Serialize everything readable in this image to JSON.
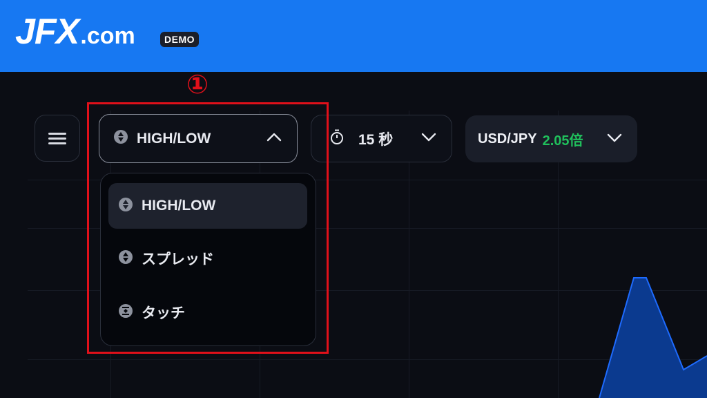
{
  "header": {
    "logo_main": "JFX",
    "logo_suffix": ".com",
    "badge": "DEMO",
    "color": "#1778f2"
  },
  "annotation": {
    "step_marker": "①",
    "highlight_color": "#e0101a"
  },
  "toolbar": {
    "menu_icon": "hamburger-icon",
    "trade_type": {
      "label": "HIGH/LOW",
      "icon": "up-down-icon",
      "expanded": true
    },
    "duration": {
      "label": "15 秒",
      "icon": "timer-icon"
    },
    "pair": {
      "label": "USD/JPY",
      "payout": "2.05倍",
      "payout_color": "#20c05c"
    }
  },
  "dropdown": {
    "options": [
      {
        "label": "HIGH/LOW",
        "icon": "up-down-icon",
        "selected": true
      },
      {
        "label": "スプレッド",
        "icon": "up-down-icon",
        "selected": false
      },
      {
        "label": "タッチ",
        "icon": "touch-icon",
        "selected": false
      }
    ]
  },
  "chart_colors": {
    "area_fill": "#0b3a8f",
    "area_stroke": "#1e6bff"
  }
}
